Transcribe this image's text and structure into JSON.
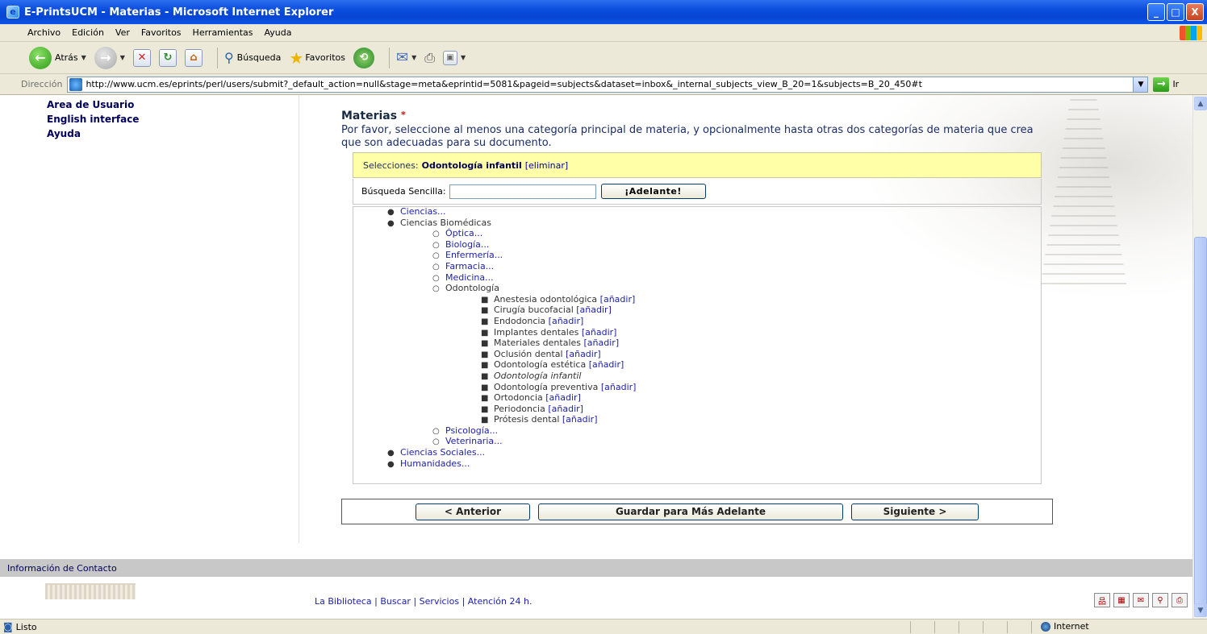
{
  "window": {
    "title": "E-PrintsUCM - Materias - Microsoft Internet Explorer",
    "minimize": "_",
    "maximize": "□",
    "close": "X"
  },
  "menu": [
    "Archivo",
    "Edición",
    "Ver",
    "Favoritos",
    "Herramientas",
    "Ayuda"
  ],
  "toolbar": {
    "back": "Atrás",
    "search": "Búsqueda",
    "favorites": "Favoritos"
  },
  "address": {
    "label": "Dirección",
    "url": "http://www.ucm.es/eprints/perl/users/submit?_default_action=null&stage=meta&eprintid=5081&pageid=subjects&dataset=inbox&_internal_subjects_view_B_20=1&subjects=B_20_450#t",
    "go": "Ir"
  },
  "sidebar": [
    "Area de Usuario",
    "English interface",
    "Ayuda"
  ],
  "main": {
    "title": "Materias",
    "required_mark": "*",
    "help": "Por favor, seleccione al menos una categoría principal de materia, y opcionalmente hasta otras dos categorías de materia que crea que son adecuadas para su documento.",
    "selection_label": "Selecciones:",
    "selection_value": "Odontología infantil",
    "selection_remove": "[eliminar]",
    "search_label": "Búsqueda Sencilla:",
    "search_value": "",
    "search_button": "¡Adelante!"
  },
  "tree": {
    "ciencias": "Ciencias...",
    "biomedicas": "Ciencias Biomédicas",
    "biomed_items": [
      "Óptica...",
      "Biología...",
      "Enfermería...",
      "Farmacia...",
      "Medicina..."
    ],
    "odontologia": "Odontología",
    "add_label": "[añadir]",
    "odonto_items": [
      "Anestesia odontológica",
      "Cirugía bucofacial",
      "Endodoncia",
      "Implantes dentales",
      "Materiales dentales",
      "Oclusión dental",
      "Odontología estética"
    ],
    "selected_item": "Odontología infantil",
    "odonto_items_after": [
      "Odontología preventiva",
      "Ortodoncia",
      "Periodoncia",
      "Prótesis dental"
    ],
    "biomed_after": [
      "Psicología...",
      "Veterinaria..."
    ],
    "sociales": "Ciencias Sociales...",
    "humanidades": "Humanidades..."
  },
  "nav": {
    "prev": "< Anterior",
    "save": "Guardar para Más Adelante",
    "next": "Siguiente >"
  },
  "footer": {
    "contact": "Información de Contacto",
    "links": [
      "La Biblioteca",
      "Buscar",
      "Servicios",
      "Atención 24 h."
    ],
    "separator": "|"
  },
  "status": {
    "text": "Listo",
    "zone": "Internet"
  }
}
